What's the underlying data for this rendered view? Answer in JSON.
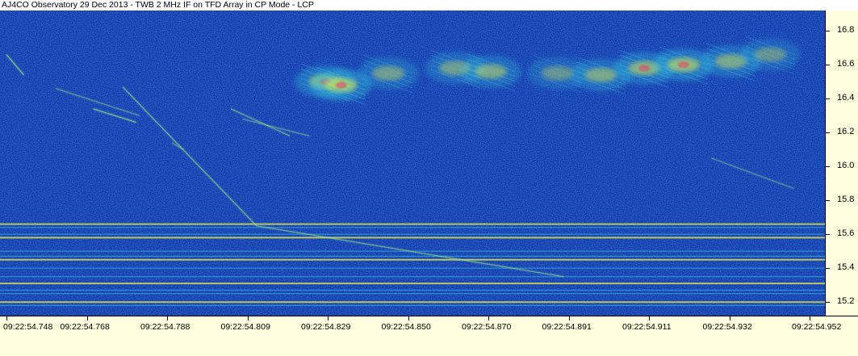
{
  "title": "AJ4CO Observatory 29 Dec 2013 - TWB 2 MHz IF on TFD Array in CP Mode - LCP",
  "chart_data": {
    "type": "heatmap",
    "title": "AJ4CO Observatory 29 Dec 2013 - TWB 2 MHz IF on TFD Array in CP Mode - LCP",
    "xlabel": "",
    "ylabel": "",
    "x_ticks": [
      "09:22:54.748",
      "09:22:54.768",
      "09:22:54.788",
      "09:22:54.809",
      "09:22:54.829",
      "09:22:54.850",
      "09:22:54.870",
      "09:22:54.891",
      "09:22:54.911",
      "09:22:54.932",
      "09:22:54.952"
    ],
    "y_ticks": [
      "15.2",
      "15.4",
      "15.6",
      "15.8",
      "16.0",
      "16.2",
      "16.4",
      "16.6",
      "16.8"
    ],
    "y_tick_values": [
      15.2,
      15.4,
      15.6,
      15.8,
      16.0,
      16.2,
      16.4,
      16.6,
      16.8
    ],
    "xlim": [
      "09:22:54.748",
      "09:22:54.952"
    ],
    "ylim": [
      15.12,
      16.92
    ],
    "yaxis_side": "right",
    "colormap": [
      "#0a2a8a",
      "#1338a6",
      "#2a6ad8",
      "#35c8e0",
      "#f2f040",
      "#f04060"
    ],
    "background_color": "#1338a6",
    "axis_background": "#ffffe0",
    "features": {
      "rfi_lines_mhz": [
        15.18,
        15.2,
        15.25,
        15.27,
        15.31,
        15.35,
        15.4,
        15.45,
        15.47,
        15.5,
        15.58,
        15.6,
        15.64,
        15.66
      ],
      "drift_bursts": [
        {
          "t0": 0.748,
          "f0": 16.66,
          "t1": 0.7524,
          "f1": 16.54,
          "intensity": 0.8
        },
        {
          "t0": 0.7605,
          "f0": 16.46,
          "t1": 0.7818,
          "f1": 16.3,
          "intensity": 0.5
        },
        {
          "t0": 0.77,
          "f0": 16.34,
          "t1": 0.781,
          "f1": 16.26,
          "intensity": 0.8
        },
        {
          "t0": 0.7775,
          "f0": 16.47,
          "t1": 0.8115,
          "f1": 15.65,
          "intensity": 0.7
        },
        {
          "t0": 0.8115,
          "f0": 15.65,
          "t1": 0.8895,
          "f1": 15.35,
          "intensity": 0.65
        },
        {
          "t0": 0.805,
          "f0": 16.34,
          "t1": 0.82,
          "f1": 16.18,
          "intensity": 0.6
        },
        {
          "t0": 0.808,
          "f0": 16.28,
          "t1": 0.825,
          "f1": 16.18,
          "intensity": 0.5
        },
        {
          "t0": 0.79,
          "f0": 16.14,
          "t1": 0.793,
          "f1": 16.1,
          "intensity": 0.5
        },
        {
          "t0": 0.927,
          "f0": 16.05,
          "t1": 0.948,
          "f1": 15.87,
          "intensity": 0.45
        }
      ],
      "burst_cluster": [
        {
          "t": 0.829,
          "f": 16.5,
          "intensity": 0.9
        },
        {
          "t": 0.833,
          "f": 16.48,
          "intensity": 1.0
        },
        {
          "t": 0.845,
          "f": 16.55,
          "intensity": 0.7
        },
        {
          "t": 0.862,
          "f": 16.58,
          "intensity": 0.7
        },
        {
          "t": 0.871,
          "f": 16.56,
          "intensity": 0.8
        },
        {
          "t": 0.888,
          "f": 16.55,
          "intensity": 0.6
        },
        {
          "t": 0.899,
          "f": 16.54,
          "intensity": 0.8
        },
        {
          "t": 0.91,
          "f": 16.58,
          "intensity": 0.9
        },
        {
          "t": 0.92,
          "f": 16.6,
          "intensity": 1.0
        },
        {
          "t": 0.932,
          "f": 16.62,
          "intensity": 0.8
        },
        {
          "t": 0.942,
          "f": 16.66,
          "intensity": 0.6
        }
      ]
    }
  }
}
